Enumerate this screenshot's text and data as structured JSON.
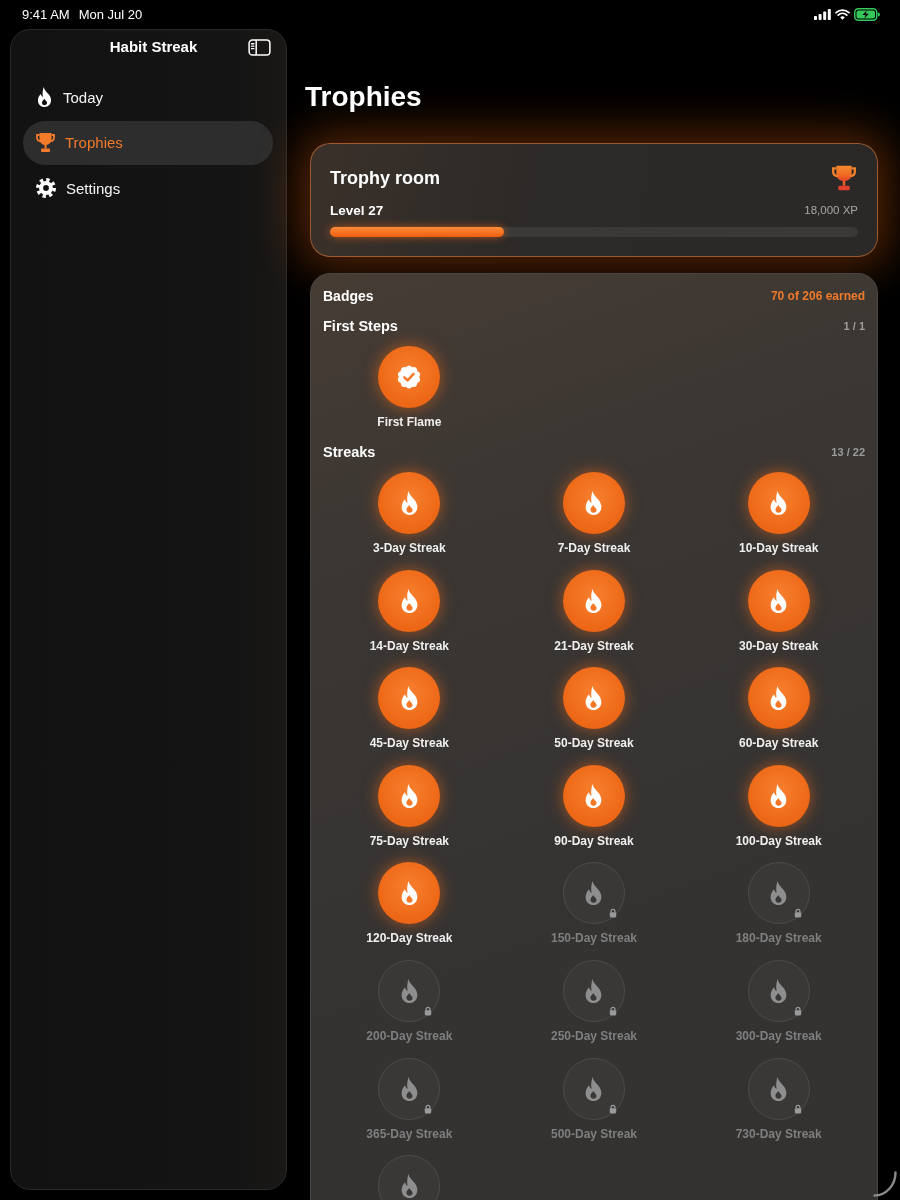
{
  "status_bar": {
    "time": "9:41 AM",
    "date": "Mon Jul 20",
    "battery_charging": true
  },
  "sidebar": {
    "title": "Habit Streak",
    "items": [
      {
        "label": "Today",
        "selected": false
      },
      {
        "label": "Trophies",
        "selected": true
      },
      {
        "label": "Settings",
        "selected": false
      }
    ]
  },
  "page": {
    "title": "Trophies"
  },
  "trophy_room": {
    "title": "Trophy room",
    "level_label": "Level 27",
    "xp": "18,000 XP",
    "level": 0.33
  },
  "badges": {
    "title": "Badges",
    "earned_summary": "70 of 206 earned",
    "sections": [
      {
        "title": "First Steps",
        "kind": "milestone",
        "count": "1 / 1",
        "items": [
          {
            "label": "First Flame",
            "earned": true
          }
        ]
      },
      {
        "title": "Streaks",
        "kind": "streak",
        "count": "13 / 22",
        "items": [
          {
            "label": "3-Day Streak",
            "earned": true
          },
          {
            "label": "7-Day Streak",
            "earned": true
          },
          {
            "label": "10-Day Streak",
            "earned": true
          },
          {
            "label": "14-Day Streak",
            "earned": true
          },
          {
            "label": "21-Day Streak",
            "earned": true
          },
          {
            "label": "30-Day Streak",
            "earned": true
          },
          {
            "label": "45-Day Streak",
            "earned": true
          },
          {
            "label": "50-Day Streak",
            "earned": true
          },
          {
            "label": "60-Day Streak",
            "earned": true
          },
          {
            "label": "75-Day Streak",
            "earned": true
          },
          {
            "label": "90-Day Streak",
            "earned": true
          },
          {
            "label": "100-Day Streak",
            "earned": true
          },
          {
            "label": "120-Day Streak",
            "earned": true
          },
          {
            "label": "150-Day Streak",
            "earned": false
          },
          {
            "label": "180-Day Streak",
            "earned": false
          },
          {
            "label": "200-Day Streak",
            "earned": false
          },
          {
            "label": "250-Day Streak",
            "earned": false
          },
          {
            "label": "300-Day Streak",
            "earned": false
          },
          {
            "label": "365-Day Streak",
            "earned": false
          },
          {
            "label": "500-Day Streak",
            "earned": false
          },
          {
            "label": "730-Day Streak",
            "earned": false
          },
          {
            "earned": false
          }
        ]
      }
    ]
  }
}
